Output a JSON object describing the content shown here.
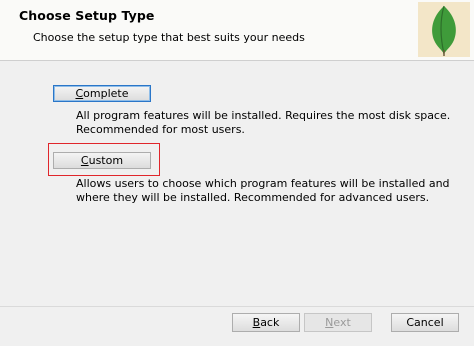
{
  "header": {
    "title": "Choose Setup Type",
    "subtitle": "Choose the setup type that best suits your needs",
    "logo_icon": "mongodb-leaf-icon"
  },
  "options": {
    "complete": {
      "label_first": "C",
      "label_rest": "omplete",
      "description": "All program features will be installed. Requires the most disk space. Recommended for most users."
    },
    "custom": {
      "label_first": "C",
      "label_rest": "ustom",
      "description": "Allows users to choose which program features will be installed and where they will be installed. Recommended for advanced users."
    }
  },
  "footer": {
    "back": {
      "first": "B",
      "rest": "ack"
    },
    "next": {
      "first": "N",
      "rest": "ext"
    },
    "cancel": "Cancel"
  },
  "colors": {
    "highlight": "#e0262b",
    "focus_border": "#2a76c8",
    "leaf_green": "#3f9b3a",
    "logo_bg": "#f3e6c8"
  }
}
